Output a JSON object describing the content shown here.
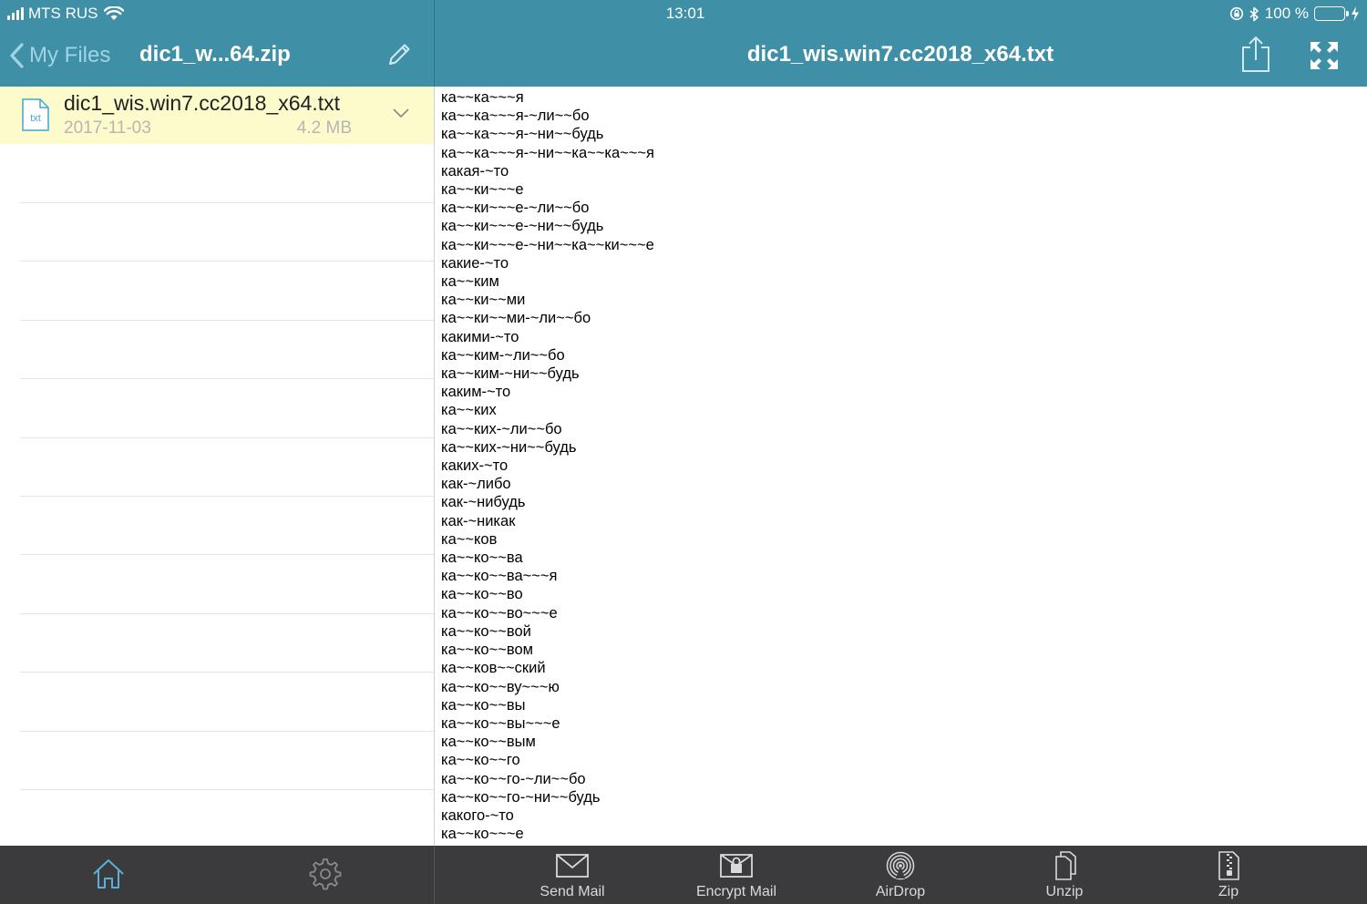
{
  "status": {
    "carrier": "MTS RUS",
    "time": "13:01",
    "battery": "100 %"
  },
  "nav": {
    "back_label": "My Files",
    "archive_title": "dic1_w...64.zip",
    "file_title": "dic1_wis.win7.cc2018_x64.txt"
  },
  "file": {
    "name": "dic1_wis.win7.cc2018_x64.txt",
    "date": "2017-11-03",
    "size": "4.2 MB",
    "icon_text": "txt"
  },
  "content": {
    "lines": [
      "ка~~ка~~~я",
      "ка~~ка~~~я-~ли~~бо",
      "ка~~ка~~~я-~ни~~будь",
      "ка~~ка~~~я-~ни~~ка~~ка~~~я",
      "какая-~то",
      "ка~~ки~~~е",
      "ка~~ки~~~е-~ли~~бо",
      "ка~~ки~~~е-~ни~~будь",
      "ка~~ки~~~е-~ни~~ка~~ки~~~е",
      "какие-~то",
      "ка~~ким",
      "ка~~ки~~ми",
      "ка~~ки~~ми-~ли~~бо",
      "какими-~то",
      "ка~~ким-~ли~~бо",
      "ка~~ким-~ни~~будь",
      "каким-~то",
      "ка~~ких",
      "ка~~ких-~ли~~бо",
      "ка~~ких-~ни~~будь",
      "каких-~то",
      "как-~либо",
      "как-~нибудь",
      "как-~никак",
      "ка~~ков",
      "ка~~ко~~ва",
      "ка~~ко~~ва~~~я",
      "ка~~ко~~во",
      "ка~~ко~~во~~~е",
      "ка~~ко~~вой",
      "ка~~ко~~вом",
      "ка~~ков~~ский",
      "ка~~ко~~ву~~~ю",
      "ка~~ко~~вы",
      "ка~~ко~~вы~~~е",
      "ка~~ко~~вым",
      "ка~~ко~~го",
      "ка~~ко~~го-~ли~~бо",
      "ка~~ко~~го-~ни~~будь",
      "какого-~то",
      "ка~~ко~~~е"
    ]
  },
  "toolbar": {
    "send_mail": "Send Mail",
    "encrypt_mail": "Encrypt Mail",
    "airdrop": "AirDrop",
    "unzip": "Unzip",
    "zip": "Zip"
  },
  "colors": {
    "nav_bar": "#3f90a6",
    "back_link": "#9fd3e5",
    "selected_row": "#fdfacb",
    "bottom_bar": "#3b3b3d",
    "tab_active": "#5ab0d6",
    "battery_fill": "#4cd964"
  },
  "icons": {
    "back": "chevron-left-icon",
    "edit": "pencil-icon",
    "share": "share-icon",
    "fullscreen": "expand-icon",
    "home": "home-icon",
    "settings": "gear-icon",
    "send_mail": "envelope-icon",
    "encrypt_mail": "lock-envelope-icon",
    "airdrop": "airdrop-icon",
    "unzip": "unzip-icon",
    "zip": "zip-icon"
  }
}
